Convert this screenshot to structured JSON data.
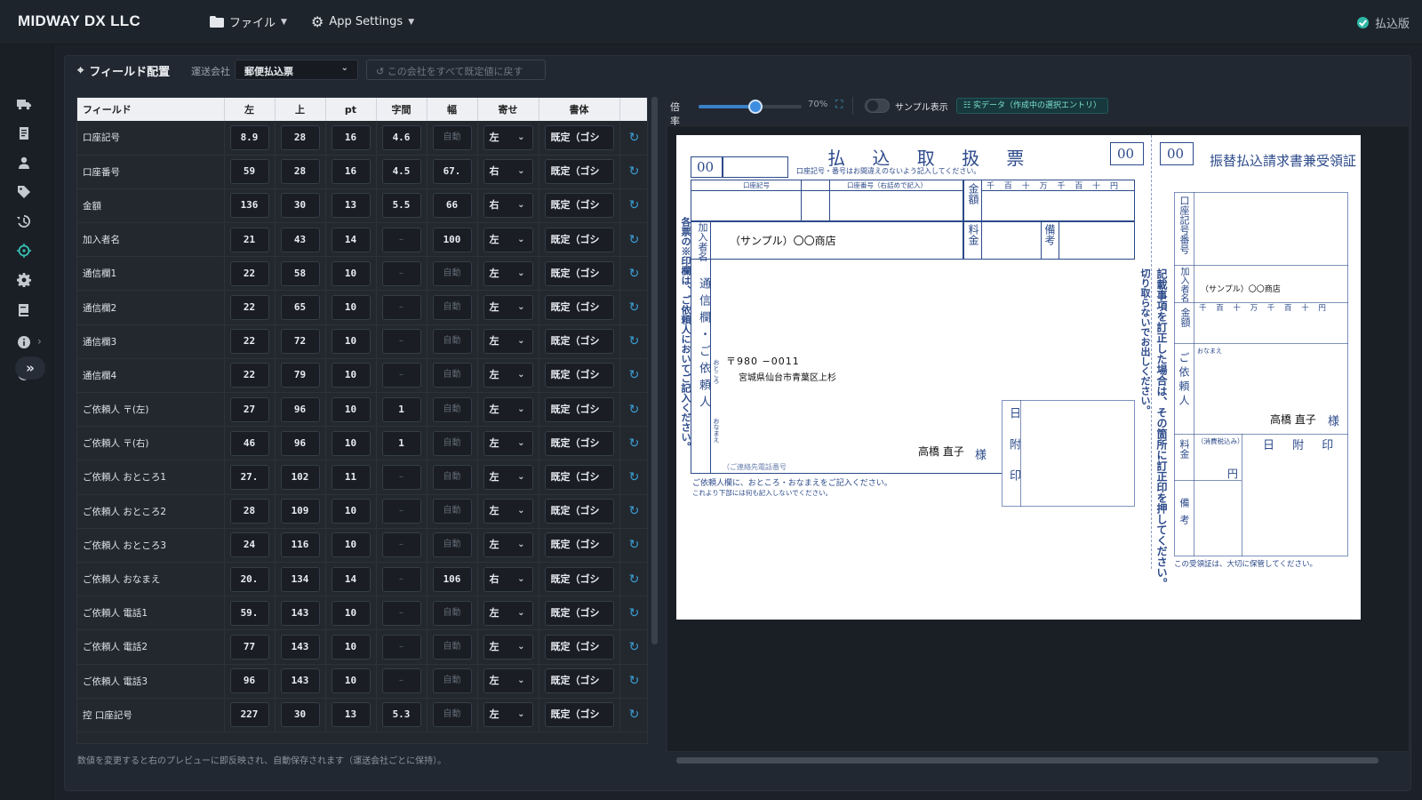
{
  "app": {
    "brand": "MIDWAY DX LLC",
    "menu_file": "ファイル",
    "menu_settings": "App Settings",
    "edition": "払込版"
  },
  "sidebar": {
    "icons": [
      "truck-icon",
      "document-icon",
      "user-icon",
      "tag-icon",
      "history-icon",
      "crosshair-icon",
      "gear-icon",
      "book-icon",
      "info-icon",
      "power-icon"
    ],
    "active": "crosshair-icon",
    "collapse_label": "»"
  },
  "panel": {
    "title": "フィールド配置",
    "carrier_label": "運送会社",
    "carrier_value": "郵便払込票",
    "reset_all_label": "この会社をすべて既定値に戻す",
    "footer_note": "数値を変更すると右のプレビューに即反映され、自動保存されます（運送会社ごとに保持）。"
  },
  "table": {
    "headers": [
      "フィールド",
      "左",
      "上",
      "pt",
      "字間",
      "幅",
      "寄せ",
      "書体"
    ],
    "rows": [
      {
        "field": "口座記号",
        "left": "8.9",
        "top": "28",
        "pt": "16",
        "spacing": "4.6",
        "width": "自動",
        "align": "左",
        "font": "既定（ゴシ"
      },
      {
        "field": "口座番号",
        "left": "59",
        "top": "28",
        "pt": "16",
        "spacing": "4.5",
        "width": "67.",
        "align": "右",
        "font": "既定（ゴシ"
      },
      {
        "field": "金額",
        "left": "136",
        "top": "30",
        "pt": "13",
        "spacing": "5.5",
        "width": "66",
        "align": "右",
        "font": "既定（ゴシ"
      },
      {
        "field": "加入者名",
        "left": "21",
        "top": "43",
        "pt": "14",
        "spacing": "–",
        "width": "100",
        "align": "左",
        "font": "既定（ゴシ"
      },
      {
        "field": "通信欄1",
        "left": "22",
        "top": "58",
        "pt": "10",
        "spacing": "–",
        "width": "自動",
        "align": "左",
        "font": "既定（ゴシ"
      },
      {
        "field": "通信欄2",
        "left": "22",
        "top": "65",
        "pt": "10",
        "spacing": "–",
        "width": "自動",
        "align": "左",
        "font": "既定（ゴシ"
      },
      {
        "field": "通信欄3",
        "left": "22",
        "top": "72",
        "pt": "10",
        "spacing": "–",
        "width": "自動",
        "align": "左",
        "font": "既定（ゴシ"
      },
      {
        "field": "通信欄4",
        "left": "22",
        "top": "79",
        "pt": "10",
        "spacing": "–",
        "width": "自動",
        "align": "左",
        "font": "既定（ゴシ"
      },
      {
        "field": "ご依頼人 〒(左)",
        "left": "27",
        "top": "96",
        "pt": "10",
        "spacing": "1",
        "width": "自動",
        "align": "左",
        "font": "既定（ゴシ"
      },
      {
        "field": "ご依頼人 〒(右)",
        "left": "46",
        "top": "96",
        "pt": "10",
        "spacing": "1",
        "width": "自動",
        "align": "左",
        "font": "既定（ゴシ"
      },
      {
        "field": "ご依頼人 おところ1",
        "left": "27.",
        "top": "102",
        "pt": "11",
        "spacing": "–",
        "width": "自動",
        "align": "左",
        "font": "既定（ゴシ"
      },
      {
        "field": "ご依頼人 おところ2",
        "left": "28",
        "top": "109",
        "pt": "10",
        "spacing": "–",
        "width": "自動",
        "align": "左",
        "font": "既定（ゴシ"
      },
      {
        "field": "ご依頼人 おところ3",
        "left": "24",
        "top": "116",
        "pt": "10",
        "spacing": "–",
        "width": "自動",
        "align": "左",
        "font": "既定（ゴシ"
      },
      {
        "field": "ご依頼人 おなまえ",
        "left": "20.",
        "top": "134",
        "pt": "14",
        "spacing": "–",
        "width": "106",
        "align": "右",
        "font": "既定（ゴシ"
      },
      {
        "field": "ご依頼人 電話1",
        "left": "59.",
        "top": "143",
        "pt": "10",
        "spacing": "–",
        "width": "自動",
        "align": "左",
        "font": "既定（ゴシ"
      },
      {
        "field": "ご依頼人 電話2",
        "left": "77",
        "top": "143",
        "pt": "10",
        "spacing": "–",
        "width": "自動",
        "align": "左",
        "font": "既定（ゴシ"
      },
      {
        "field": "ご依頼人 電話3",
        "left": "96",
        "top": "143",
        "pt": "10",
        "spacing": "–",
        "width": "自動",
        "align": "左",
        "font": "既定（ゴシ"
      },
      {
        "field": "控 口座記号",
        "left": "227",
        "top": "30",
        "pt": "13",
        "spacing": "5.3",
        "width": "自動",
        "align": "左",
        "font": "既定（ゴシ"
      }
    ]
  },
  "preview": {
    "zoom_label": "倍率",
    "zoom_value": "70%",
    "zoom_fraction": 0.55,
    "sample_toggle_label": "サンプル表示",
    "sample_toggle_on": false,
    "data_badge": "实データ（作成中の選択エントリ）",
    "form": {
      "main_title": "払 込 取 扱 票",
      "code_left": "00",
      "code_right": "00",
      "code_stub": "00",
      "subtitle_note": "口座記号・番号はお間違えのないよう記入してください。",
      "col_account_symbol": "口座記号",
      "col_account_number": "口座番号（右詰めで記入）",
      "amount_label": "金額",
      "amount_units": "千 百 十 万 千 百 十 円",
      "fee_label": "料金",
      "remarks_label": "備考",
      "payee_label": "加入者名",
      "payee_value": "（サンプル）〇〇商店",
      "comm_label": "通信欄・ご依頼人",
      "zip": "〒980  −0011",
      "address": "宮城県仙台市青葉区上杉",
      "address_label": "おところ",
      "name_label": "おなまえ",
      "requester_name": "高橋 直子",
      "honorific": "様",
      "phone_label": "（ご連絡先電話番号",
      "notice1": "ご依頼人欄に、おところ・おなまえをご記入ください。",
      "notice2": "これより下部には何も記入しないでください。",
      "date_stamp_label": "日附印",
      "left_vertical": "各票の※印欄は、ご依頼人においてご記入ください。",
      "cut_vertical": "切り取らないでお出しください。",
      "correction_vertical": "記載事項を訂正した場合は、その箇所に訂正印を押してください。",
      "stub_title": "振替払込請求書兼受領証",
      "stub_account_label": "口座記号番号",
      "stub_payee_label": "加入者名",
      "stub_payee_value": "（サンプル）〇〇商店",
      "stub_amount_label": "金額",
      "stub_requester_label": "ご依頼人",
      "stub_name_label": "おなまえ",
      "stub_requester_name": "高橋 直子",
      "stub_fee_label": "料金",
      "stub_tax_note": "（消費税込み）",
      "stub_yen": "円",
      "stub_date_label": "日 附 印",
      "stub_remarks_label": "備考",
      "stub_footer": "この受領証は、大切に保管してください。"
    }
  }
}
